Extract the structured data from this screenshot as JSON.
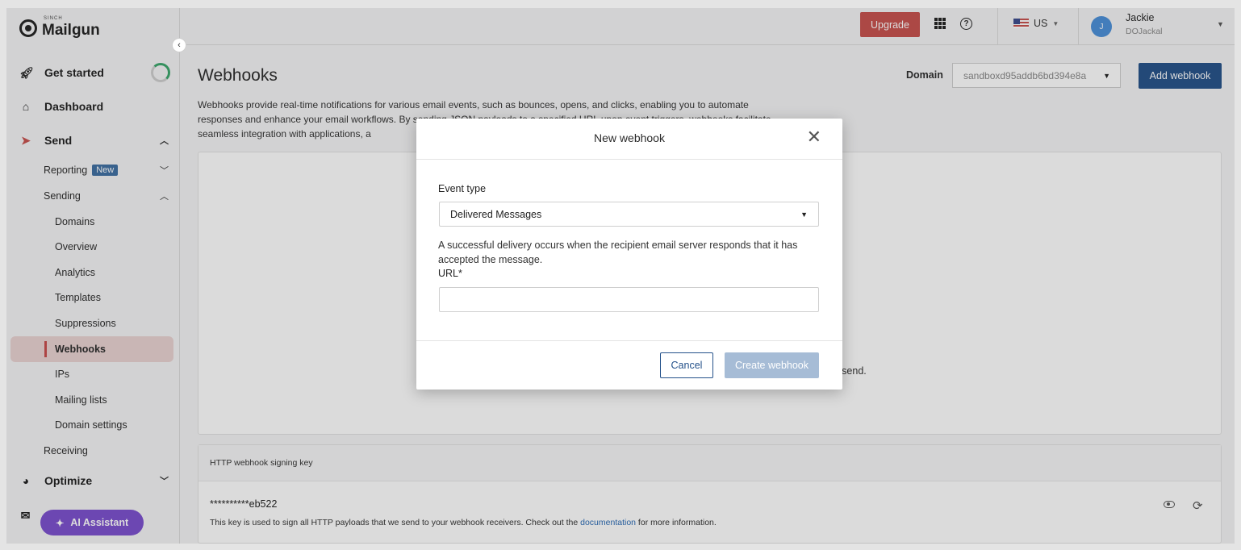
{
  "brand": {
    "sinch": "SINCH",
    "name": "Mailgun"
  },
  "sidebar": {
    "top_items": [
      {
        "label": "Get started",
        "icon": "rocket-icon"
      },
      {
        "label": "Dashboard",
        "icon": "home-icon"
      },
      {
        "label": "Send",
        "icon": "paper-plane-icon"
      }
    ],
    "send_children": [
      {
        "label": "Reporting",
        "badge": "New"
      },
      {
        "label": "Sending"
      }
    ],
    "sending_children": [
      "Domains",
      "Overview",
      "Analytics",
      "Templates",
      "Suppressions",
      "Webhooks",
      "IPs",
      "Mailing lists",
      "Domain settings"
    ],
    "receiving": "Receiving",
    "optimize": "Optimize",
    "ai_assistant": "AI Assistant",
    "active_item": "Webhooks"
  },
  "topbar": {
    "upgrade": "Upgrade",
    "region": "US",
    "user": {
      "initial": "J",
      "name": "Jackie",
      "org": "DOJackal"
    }
  },
  "main": {
    "title": "Webhooks",
    "domain_label": "Domain",
    "domain_value": "sandboxd95addb6bd394e8a",
    "add_webhook": "Add webhook",
    "description": "Webhooks provide real-time notifications for various email events, such as bounces, opens, and clicks, enabling you to automate responses and enhance your email workflows. By sending JSON payloads to a specified URL upon event triggers, webhooks facilitate seamless integration with applications, a",
    "empty_state_text": "otifications on events linked to the messages you send."
  },
  "signing_key": {
    "header": "HTTP webhook signing key",
    "value": "**********eb522",
    "help_prefix": "This key is used to sign all HTTP payloads that we send to your webhook receivers. Check out the ",
    "help_link": "documentation",
    "help_suffix": " for more information."
  },
  "modal": {
    "title": "New webhook",
    "event_type_label": "Event type",
    "event_type_value": "Delivered Messages",
    "event_help": "A successful delivery occurs when the recipient email server responds that it has accepted the message.",
    "url_label": "URL*",
    "url_value": "",
    "cancel": "Cancel",
    "create": "Create webhook"
  },
  "colors": {
    "accent_red": "#c8504d",
    "primary_blue": "#24518a",
    "disabled_blue": "#a6bcd6",
    "ai_purple": "#7b4fcf",
    "active_nav_bg": "#ead3d2"
  }
}
